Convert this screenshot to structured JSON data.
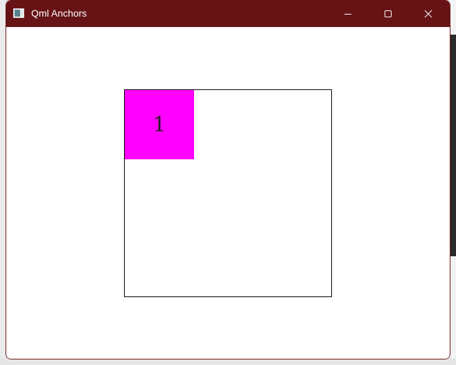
{
  "window": {
    "title": "Qml Anchors"
  },
  "icons": {
    "app": "app-window-icon",
    "minimize": "minimize-icon",
    "maximize": "maximize-icon",
    "close": "close-icon"
  },
  "colors": {
    "titlebar": "#671316",
    "rect_fill": "#ff00ff",
    "outer_border": "#000000"
  },
  "content": {
    "rect_label": "1"
  }
}
